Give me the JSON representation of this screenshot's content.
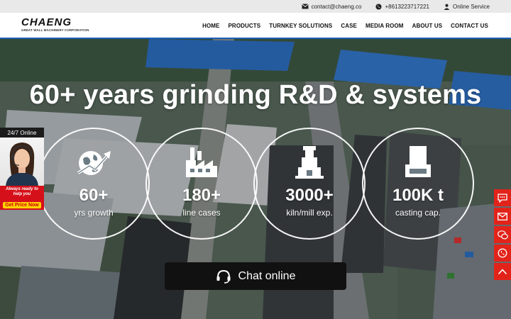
{
  "topbar": {
    "email": "contact@chaeng.co",
    "phone": "+8613223717221",
    "service": "Online Service"
  },
  "brand": {
    "name": "CHAENG",
    "tagline": "GREAT WALL MACHINERY CORPORATION"
  },
  "nav": {
    "items": [
      "HOME",
      "PRODUCTS",
      "TURNKEY SOLUTIONS",
      "CASE",
      "MEDIA ROOM",
      "ABOUT US",
      "CONTACT US"
    ]
  },
  "hero": {
    "title": "60+ years grinding R&D & systems",
    "stats": [
      {
        "value": "60+",
        "label": "yrs growth",
        "icon": "globe-growth-icon"
      },
      {
        "value": "180+",
        "label": "line cases",
        "icon": "factory-icon"
      },
      {
        "value": "3000+",
        "label": "kiln/mill exp.",
        "icon": "mill-machine-icon"
      },
      {
        "value": "100K t",
        "label": "casting cap.",
        "icon": "casting-ladle-icon"
      }
    ],
    "chat_label": "Chat online"
  },
  "widget": {
    "status": "24/7 Online",
    "tagline_1": "Always ready to",
    "tagline_2": "help you",
    "cta": "Get Price Now"
  },
  "right_tools": [
    "chat-icon",
    "mail-icon",
    "wechat-icon",
    "whatsapp-icon",
    "back-to-top-icon"
  ],
  "colors": {
    "accent_blue": "#1a5fb4",
    "tool_red": "#e2231a",
    "cta_yellow": "#ffd200"
  }
}
